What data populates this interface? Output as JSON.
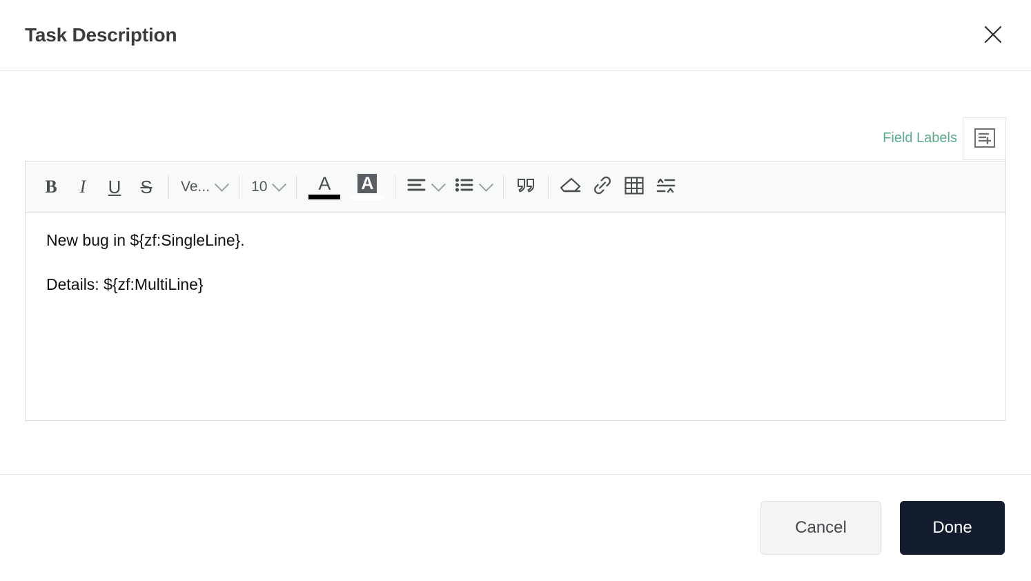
{
  "header": {
    "title": "Task Description",
    "close_icon": "close-icon"
  },
  "field_labels": {
    "link_label": "Field Labels",
    "insert_icon": "insert-field-label-icon",
    "link_color": "#5aab88"
  },
  "toolbar": {
    "bold": "B",
    "italic": "I",
    "underline": "U",
    "strikethrough": "S",
    "font_family": "Ve...",
    "font_size": "10",
    "text_color_glyph": "A",
    "background_color_glyph": "A",
    "align_icon": "align-left-icon",
    "list_icon": "bullet-list-icon",
    "quote_icon": "blockquote-icon",
    "eraser_icon": "clear-formatting-icon",
    "link_icon": "insert-link-icon",
    "table_icon": "insert-table-icon",
    "spacing_icon": "line-spacing-icon",
    "text_color_swatch": "#000000",
    "background_color_swatch": "#ffffff"
  },
  "editor": {
    "paragraphs": [
      "New bug in ${zf:SingleLine}.",
      "Details: ${zf:MultiLine}"
    ],
    "line1": "New bug in ${zf:SingleLine}.",
    "line2": "Details: ${zf:MultiLine}"
  },
  "footer": {
    "cancel_label": "Cancel",
    "done_label": "Done",
    "done_bg": "#141d2e"
  }
}
